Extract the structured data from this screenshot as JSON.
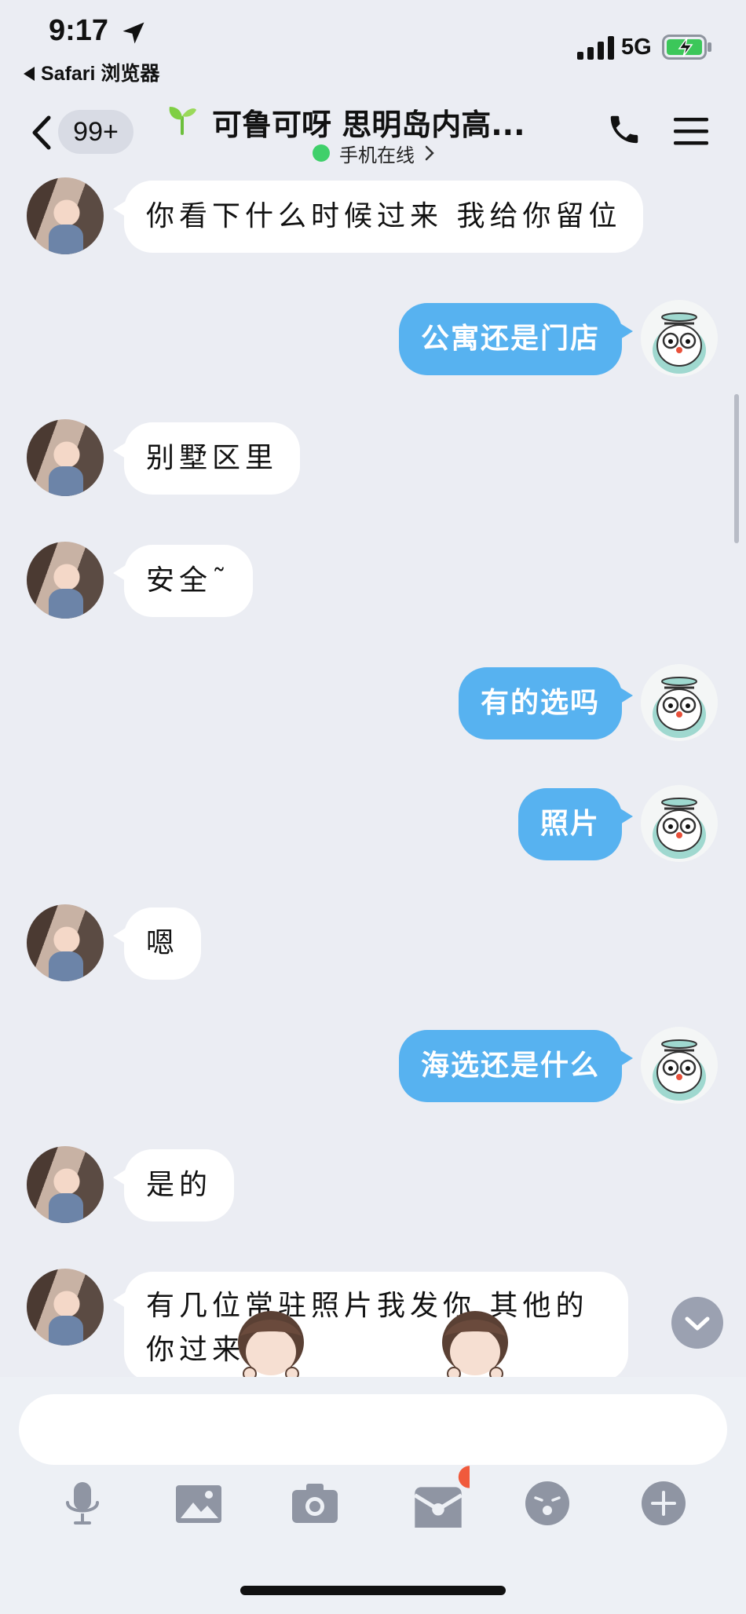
{
  "status_bar": {
    "time": "9:17",
    "back_app": "Safari 浏览器",
    "network": "5G"
  },
  "header": {
    "unread_count": "99+",
    "title": "可鲁可呀 思明岛内高...",
    "presence": "手机在线",
    "presence_color": "#3fd06a"
  },
  "messages": [
    {
      "side": "in",
      "text": "你看下什么时候过来  我给你留位"
    },
    {
      "side": "out",
      "text": "公寓还是门店"
    },
    {
      "side": "in",
      "text": "别墅区里"
    },
    {
      "side": "in",
      "text": "安全˜"
    },
    {
      "side": "out",
      "text": "有的选吗"
    },
    {
      "side": "out",
      "text": "照片"
    },
    {
      "side": "in",
      "text": "嗯"
    },
    {
      "side": "out",
      "text": "海选还是什么"
    },
    {
      "side": "in",
      "text": "是的"
    },
    {
      "side": "in",
      "text": "有几位常驻照片我发你 其他的你过来选"
    }
  ],
  "input": {
    "value": "",
    "placeholder": ""
  },
  "toolbar": {
    "icons": [
      "microphone-icon",
      "image-icon",
      "camera-icon",
      "red-packet-icon",
      "emoji-icon",
      "plus-icon"
    ]
  },
  "colors": {
    "background": "#ebedf3",
    "outgoing_bubble": "#57b2f0",
    "incoming_bubble": "#ffffff",
    "notification_dot": "#f05a3c"
  }
}
